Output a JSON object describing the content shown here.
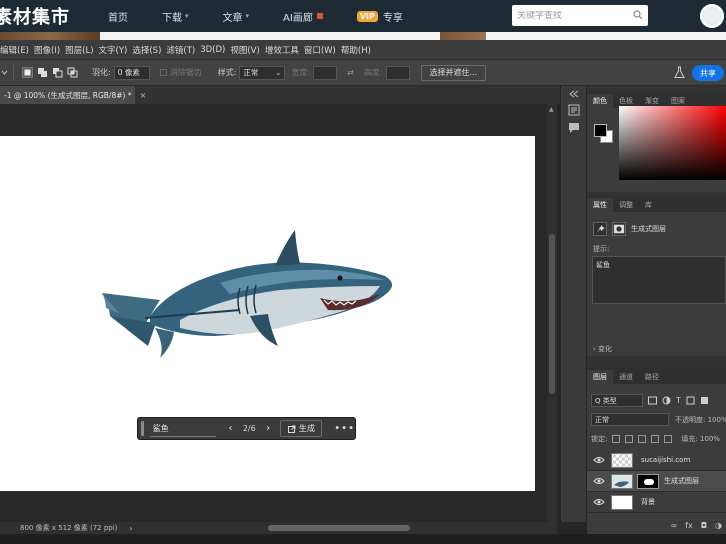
{
  "site": {
    "logo": "素材集市",
    "nav": [
      {
        "label": "首页",
        "has_caret": false
      },
      {
        "label": "下载",
        "has_caret": true
      },
      {
        "label": "文章",
        "has_caret": true
      },
      {
        "label": "AI画廊",
        "has_caret": false
      }
    ],
    "vip_badge": "VIP",
    "vip_label": "专享",
    "search_placeholder": "关键字查找"
  },
  "ps": {
    "menu": [
      "编辑(E)",
      "图像(I)",
      "图层(L)",
      "文字(Y)",
      "选择(S)",
      "滤镜(T)",
      "3D(D)",
      "视图(V)",
      "增效工具",
      "窗口(W)",
      "帮助(H)"
    ],
    "options": {
      "feather_label": "羽化:",
      "feather_value": "0 像素",
      "antialias_label": "消除锯齿",
      "style_label": "样式:",
      "style_value": "正常",
      "width_label": "宽度:",
      "height_label": "高度:",
      "select_mask_button": "选择并遮住...",
      "share_button": "共享"
    },
    "document_tab": "-1 @ 100% (生成式图层, RGB/8#) *",
    "document_tab_close": "×",
    "task_bar": {
      "prompt": "鲨鱼",
      "prev": "‹",
      "counter": "2/6",
      "next": "›",
      "generate": "生成",
      "more": "•••"
    },
    "status": {
      "doc_size": "800 像素 x 512 像素 (72 ppi)",
      "caret": "›"
    }
  },
  "panels": {
    "color_tabs": [
      "颜色",
      "色板",
      "渐变",
      "图案"
    ],
    "properties_tabs": [
      "属性",
      "调整",
      "库"
    ],
    "properties_layer_label": "生成式图层",
    "prompt_heading": "提示:",
    "prompt_text": "鲨鱼",
    "variations_label": "› 变化",
    "layers_tabs": [
      "图层",
      "通道",
      "路径"
    ],
    "kind_select": "Q 类型",
    "blend_mode": "正常",
    "opacity_label": "不透明度: 100%",
    "lock_label": "锁定:",
    "fill_label": "填充: 100%",
    "layers": [
      {
        "name": "sucaijishi.com",
        "thumb": "checker",
        "selected": false
      },
      {
        "name": "生成式图层",
        "thumb": "shark",
        "selected": true
      },
      {
        "name": "背景",
        "thumb": "white",
        "selected": false
      }
    ],
    "footer_icons": [
      "∞",
      "fx",
      "◘",
      "◑"
    ]
  },
  "colors": {
    "site_header_bg": "#1e2b35",
    "ps_dark": "#3c3c3c",
    "share_blue": "#1473e6",
    "vip_orange": "#f0a436"
  }
}
